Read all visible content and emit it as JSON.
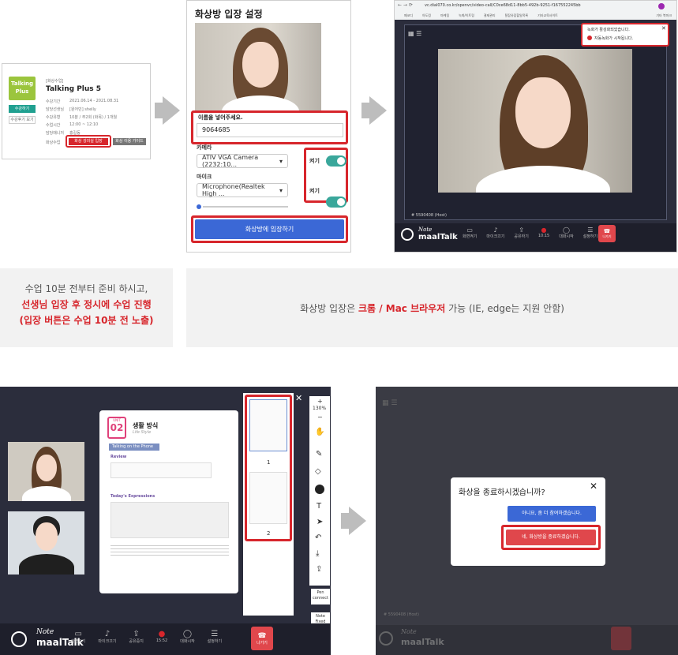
{
  "course_card": {
    "badge_title": "Talking Plus",
    "enroll_button": "수강하기",
    "review_button": "수강후기 보기",
    "category": "[화상수업]",
    "title": "Talking Plus 5",
    "rows": [
      {
        "label": "수강기간",
        "value": "2021.06.14 - 2021.08.31"
      },
      {
        "label": "담당선생님",
        "value": "[원어민] shelly"
      },
      {
        "label": "수강유형",
        "value": "10분 / 주2회 (화목) / 1개월"
      },
      {
        "label": "수업시간",
        "value": "12:00 ~ 12:10"
      },
      {
        "label": "담당매니저",
        "value": "홍길동"
      }
    ],
    "enter_label": "화상수업",
    "enter_button": "화상 강의실 입장",
    "guide_button": "화상 이용 가이드"
  },
  "entry_panel": {
    "title": "화상방 입장 설정",
    "name_label": "이름을 넣어주세요.",
    "name_value": "9064685",
    "camera_label": "카메라",
    "camera_value": "ATIV VGA Camera (2232:10...",
    "mic_label": "마이크",
    "mic_value": "Microphone(Realtek High ...",
    "toggle_on_label": "켜기",
    "enter_button": "화상방에 입장하기"
  },
  "browser": {
    "url": "vc.dial070.co.kr/openvc/video-call/C0ce68d11-8bb5-492b-9251-f167552245bb",
    "bookmarks": [
      "페코디",
      "아도킹",
      "마케팅",
      "녹화/이트링",
      "결제관리",
      "탈잡유잡할일목록",
      "기타교육사이트"
    ],
    "bookmarks_more": "기타 북마크",
    "notice_title": "녹화가 활성화되었습니다.",
    "notice_text": "자동녹화가 시작됩니다.",
    "user_tag": "# 5590408 (Host)"
  },
  "toolbar": {
    "brand_top": "Note",
    "brand_bottom": "maalTalk",
    "items": [
      "화면켜기",
      "마이크끄기",
      "공유하기",
      "10:15",
      "대화시작",
      "설정하기"
    ],
    "exit": "나가기",
    "items_bottom": [
      "화면끄기",
      "마이크끄기",
      "공유중지",
      "15:52",
      "대화시작",
      "설정하기"
    ]
  },
  "captions": {
    "left_line1": "수업 10분 전부터 준비 하시고,",
    "left_line2": "선생님 입장 후 정시에 수업 진행",
    "left_line3": "(입장 버튼은 수업 10분 전 노출)",
    "right_pre": "화상방 입장은 ",
    "right_highlight": "크롬 / Mac 브라우저",
    "right_post": " 가능 (IE, edge는 지원 안함)"
  },
  "lesson": {
    "unit_label": "UNIT",
    "unit_number": "02",
    "unit_title": "생활 방식",
    "unit_subtitle": "Life Style",
    "tab_title": "Talking on the Phone",
    "review_title": "Review",
    "expressions_title": "Today's Expressions",
    "page1": "1",
    "page2": "2",
    "zoom": "130%",
    "zoom_plus": "+",
    "zoom_minus": "−",
    "pen_label": "Pen connect",
    "note_label": "Note Fixed"
  },
  "dialog": {
    "title": "화상을 종료하시겠습니까?",
    "stay_button": "아니요, 좀 더 참여하겠습니다.",
    "end_button": "네, 화상방을 종료하겠습니다."
  },
  "colors": {
    "accent_red": "#d7262c",
    "primary_blue": "#3b68d6",
    "toggle_green": "#3aa79b",
    "dark_bg": "#2b2d3c"
  }
}
